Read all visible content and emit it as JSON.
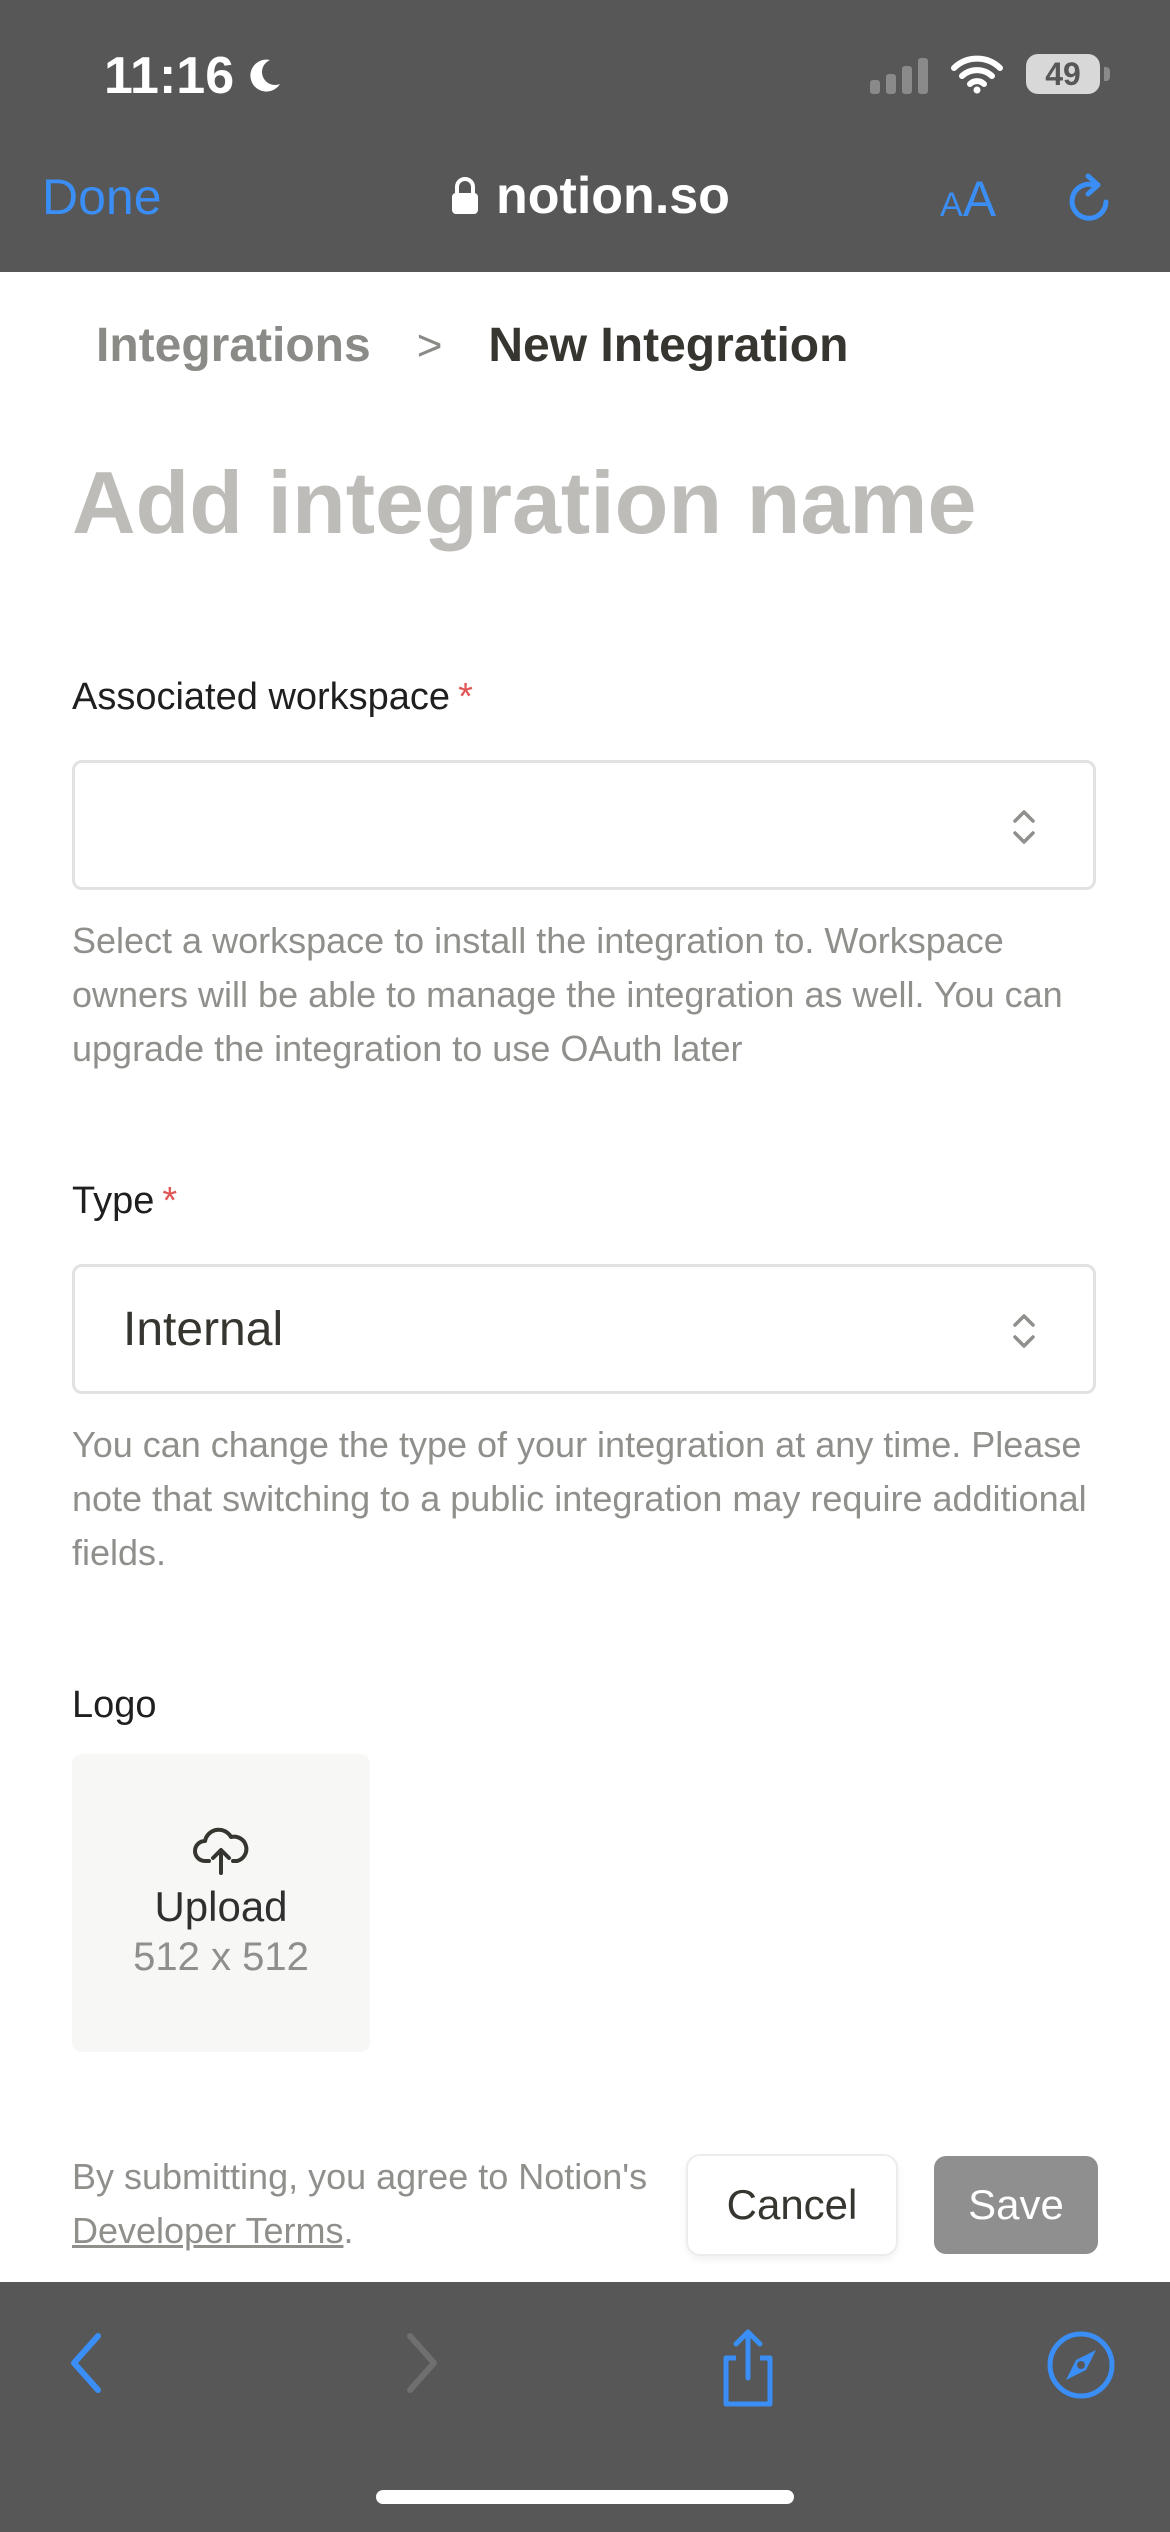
{
  "status_bar": {
    "time": "11:16",
    "battery": "49"
  },
  "browser": {
    "done_label": "Done",
    "url": "notion.so",
    "text_size_label_small": "A",
    "text_size_label_large": "A"
  },
  "breadcrumb": {
    "parent": "Integrations",
    "separator": ">",
    "current": "New Integration"
  },
  "form": {
    "title_placeholder": "Add integration name",
    "workspace": {
      "label": "Associated workspace",
      "required_mark": "*",
      "value": "",
      "help": "Select a workspace to install the integration to. Workspace owners will be able to manage the integration as well. You can upgrade the integration to use OAuth later"
    },
    "type": {
      "label": "Type",
      "required_mark": "*",
      "value": "Internal",
      "help": "You can change the type of your integration at any time. Please note that switching to a public integration may require additional fields."
    },
    "logo": {
      "label": "Logo",
      "upload_label": "Upload",
      "size_hint": "512 x 512"
    },
    "terms": {
      "prefix": "By submitting, you agree to Notion's ",
      "link_text": "Developer Terms",
      "suffix": "."
    },
    "cancel_label": "Cancel",
    "save_label": "Save"
  },
  "colors": {
    "accent": "#3a8ef6",
    "required": "#e25555",
    "chrome_bg": "#575757",
    "save_disabled": "#8f8f8f"
  },
  "icons": [
    "moon-icon",
    "signal-icon",
    "wifi-icon",
    "battery-icon",
    "lock-icon",
    "reload-icon",
    "chevron-up-down-icon",
    "cloud-upload-icon",
    "back-icon",
    "forward-icon",
    "share-icon",
    "compass-icon"
  ]
}
